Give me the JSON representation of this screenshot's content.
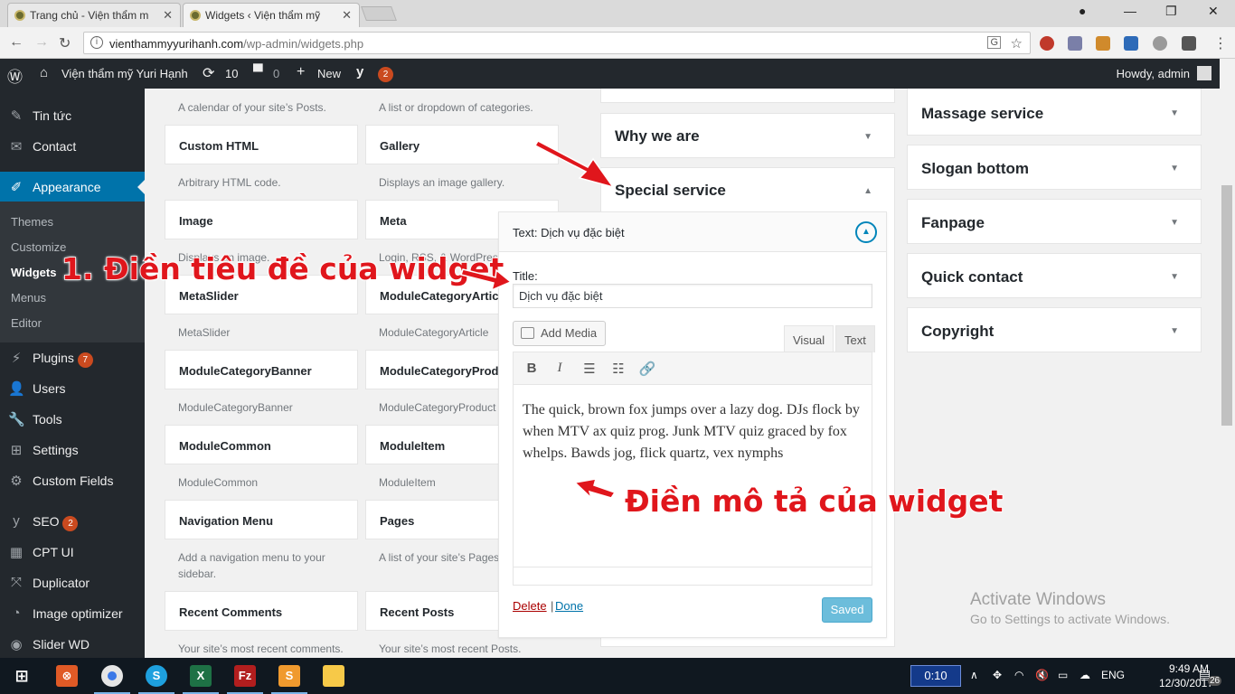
{
  "browser": {
    "tabs": [
      {
        "label": "Trang chủ - Viện thẩm m"
      },
      {
        "label": "Widgets ‹ Viện thẩm mỹ"
      }
    ],
    "url_domain": "vienthammyyurihanh.com",
    "url_path": "/wp-admin/widgets.php"
  },
  "admin_bar": {
    "site_name": "Viện thẩm mỹ Yuri Hạnh",
    "updates": "10",
    "comments": "0",
    "new_label": "New",
    "yoast_count": "2",
    "howdy": "Howdy, admin"
  },
  "sidebar": {
    "items": [
      {
        "label": "Tin tức"
      },
      {
        "label": "Contact"
      },
      {
        "label": "Appearance"
      },
      {
        "label": "Plugins",
        "badge": "7"
      },
      {
        "label": "Users"
      },
      {
        "label": "Tools"
      },
      {
        "label": "Settings"
      },
      {
        "label": "Custom Fields"
      },
      {
        "label": "SEO",
        "badge": "2"
      },
      {
        "label": "CPT UI"
      },
      {
        "label": "Duplicator"
      },
      {
        "label": "Image optimizer"
      },
      {
        "label": "Slider WD"
      }
    ],
    "submenu": [
      "Themes",
      "Customize",
      "Widgets",
      "Menus",
      "Editor"
    ]
  },
  "widgets": {
    "top_descriptions": [
      "A calendar of your site’s Posts.",
      "A list or dropdown of categories."
    ],
    "rows": [
      {
        "left": {
          "name": "Custom HTML",
          "desc": "Arbitrary HTML code."
        },
        "right": {
          "name": "Gallery",
          "desc": "Displays an image gallery."
        }
      },
      {
        "left": {
          "name": "Image",
          "desc": "Displays an image."
        },
        "right": {
          "name": "Meta",
          "desc": "Login, RSS, & WordPress."
        }
      },
      {
        "left": {
          "name": "MetaSlider",
          "desc": "MetaSlider"
        },
        "right": {
          "name": "ModuleCategoryArticle",
          "desc": "ModuleCategoryArticle"
        }
      },
      {
        "left": {
          "name": "ModuleCategoryBanner",
          "desc": "ModuleCategoryBanner"
        },
        "right": {
          "name": "ModuleCategoryProduct",
          "desc": "ModuleCategoryProduct"
        }
      },
      {
        "left": {
          "name": "ModuleCommon",
          "desc": "ModuleCommon"
        },
        "right": {
          "name": "ModuleItem",
          "desc": "ModuleItem"
        }
      },
      {
        "left": {
          "name": "Navigation Menu",
          "desc": "Add a navigation menu to your sidebar."
        },
        "right": {
          "name": "Pages",
          "desc": "A list of your site’s Pages."
        }
      },
      {
        "left": {
          "name": "Recent Comments",
          "desc": "Your site’s most recent comments."
        },
        "right": {
          "name": "Recent Posts",
          "desc": "Your site’s most recent Posts."
        }
      }
    ]
  },
  "middle_sidebar": {
    "items": [
      "Why we are",
      "Special service"
    ]
  },
  "right_sidebars": [
    "Massage service",
    "Slogan bottom",
    "Fanpage",
    "Quick contact",
    "Copyright"
  ],
  "widget_form": {
    "header_prefix": "Text:",
    "header_title": "Dịch vụ đặc biệt",
    "title_label": "Title:",
    "title_value": "Dịch vụ đặc biệt",
    "add_media": "Add Media",
    "tab_visual": "Visual",
    "tab_text": "Text",
    "content": "The quick, brown fox jumps over a lazy dog. DJs flock by when MTV ax quiz prog. Junk MTV quiz graced by fox whelps. Bawds jog, flick quartz, vex nymphs",
    "delete": "Delete",
    "separator": "|",
    "done": "Done",
    "saved": "Saved"
  },
  "annotations": {
    "step1": "1. Điền tiêu đề của widget",
    "step2": "Điền mô tả của widget"
  },
  "watermark": {
    "line1": "Activate Windows",
    "line2": "Go to Settings to activate Windows."
  },
  "taskbar": {
    "timer": "0:10",
    "lang": "ENG",
    "time": "9:49 AM",
    "date": "12/30/2017",
    "notifications": "26"
  },
  "colors": {
    "wp_dark": "#23282d",
    "wp_blue": "#0073aa",
    "annotation_red": "#e0161c"
  }
}
